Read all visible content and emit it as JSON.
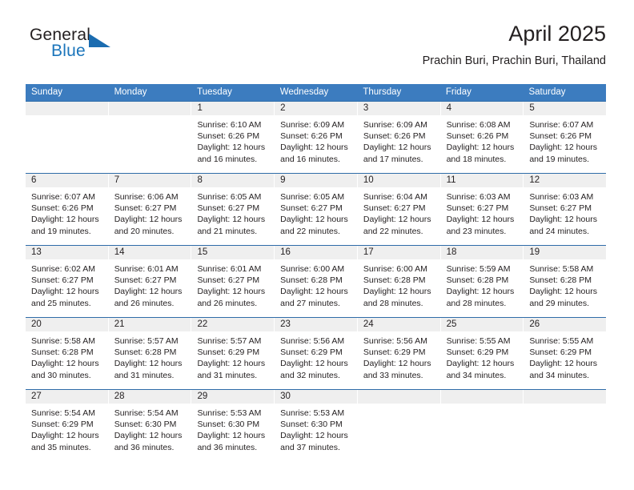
{
  "brand": {
    "name_part1": "General",
    "name_part2": "Blue"
  },
  "header": {
    "title": "April 2025",
    "location": "Prachin Buri, Prachin Buri, Thailand"
  },
  "colors": {
    "header_blue": "#3c7cbf",
    "row_divider_blue": "#2f6ca8",
    "day_band_gray": "#efefef",
    "brand_blue": "#1b75bb",
    "text": "#231f20"
  },
  "weekdays": [
    "Sunday",
    "Monday",
    "Tuesday",
    "Wednesday",
    "Thursday",
    "Friday",
    "Saturday"
  ],
  "labels": {
    "sunrise_prefix": "Sunrise:",
    "sunset_prefix": "Sunset:",
    "daylight_prefix": "Daylight:"
  },
  "weeks": [
    [
      {
        "day": "",
        "sunrise": "",
        "sunset": "",
        "daylight_line1": "",
        "daylight_line2": ""
      },
      {
        "day": "",
        "sunrise": "",
        "sunset": "",
        "daylight_line1": "",
        "daylight_line2": ""
      },
      {
        "day": "1",
        "sunrise": "Sunrise: 6:10 AM",
        "sunset": "Sunset: 6:26 PM",
        "daylight_line1": "Daylight: 12 hours",
        "daylight_line2": "and 16 minutes."
      },
      {
        "day": "2",
        "sunrise": "Sunrise: 6:09 AM",
        "sunset": "Sunset: 6:26 PM",
        "daylight_line1": "Daylight: 12 hours",
        "daylight_line2": "and 16 minutes."
      },
      {
        "day": "3",
        "sunrise": "Sunrise: 6:09 AM",
        "sunset": "Sunset: 6:26 PM",
        "daylight_line1": "Daylight: 12 hours",
        "daylight_line2": "and 17 minutes."
      },
      {
        "day": "4",
        "sunrise": "Sunrise: 6:08 AM",
        "sunset": "Sunset: 6:26 PM",
        "daylight_line1": "Daylight: 12 hours",
        "daylight_line2": "and 18 minutes."
      },
      {
        "day": "5",
        "sunrise": "Sunrise: 6:07 AM",
        "sunset": "Sunset: 6:26 PM",
        "daylight_line1": "Daylight: 12 hours",
        "daylight_line2": "and 19 minutes."
      }
    ],
    [
      {
        "day": "6",
        "sunrise": "Sunrise: 6:07 AM",
        "sunset": "Sunset: 6:26 PM",
        "daylight_line1": "Daylight: 12 hours",
        "daylight_line2": "and 19 minutes."
      },
      {
        "day": "7",
        "sunrise": "Sunrise: 6:06 AM",
        "sunset": "Sunset: 6:27 PM",
        "daylight_line1": "Daylight: 12 hours",
        "daylight_line2": "and 20 minutes."
      },
      {
        "day": "8",
        "sunrise": "Sunrise: 6:05 AM",
        "sunset": "Sunset: 6:27 PM",
        "daylight_line1": "Daylight: 12 hours",
        "daylight_line2": "and 21 minutes."
      },
      {
        "day": "9",
        "sunrise": "Sunrise: 6:05 AM",
        "sunset": "Sunset: 6:27 PM",
        "daylight_line1": "Daylight: 12 hours",
        "daylight_line2": "and 22 minutes."
      },
      {
        "day": "10",
        "sunrise": "Sunrise: 6:04 AM",
        "sunset": "Sunset: 6:27 PM",
        "daylight_line1": "Daylight: 12 hours",
        "daylight_line2": "and 22 minutes."
      },
      {
        "day": "11",
        "sunrise": "Sunrise: 6:03 AM",
        "sunset": "Sunset: 6:27 PM",
        "daylight_line1": "Daylight: 12 hours",
        "daylight_line2": "and 23 minutes."
      },
      {
        "day": "12",
        "sunrise": "Sunrise: 6:03 AM",
        "sunset": "Sunset: 6:27 PM",
        "daylight_line1": "Daylight: 12 hours",
        "daylight_line2": "and 24 minutes."
      }
    ],
    [
      {
        "day": "13",
        "sunrise": "Sunrise: 6:02 AM",
        "sunset": "Sunset: 6:27 PM",
        "daylight_line1": "Daylight: 12 hours",
        "daylight_line2": "and 25 minutes."
      },
      {
        "day": "14",
        "sunrise": "Sunrise: 6:01 AM",
        "sunset": "Sunset: 6:27 PM",
        "daylight_line1": "Daylight: 12 hours",
        "daylight_line2": "and 26 minutes."
      },
      {
        "day": "15",
        "sunrise": "Sunrise: 6:01 AM",
        "sunset": "Sunset: 6:27 PM",
        "daylight_line1": "Daylight: 12 hours",
        "daylight_line2": "and 26 minutes."
      },
      {
        "day": "16",
        "sunrise": "Sunrise: 6:00 AM",
        "sunset": "Sunset: 6:28 PM",
        "daylight_line1": "Daylight: 12 hours",
        "daylight_line2": "and 27 minutes."
      },
      {
        "day": "17",
        "sunrise": "Sunrise: 6:00 AM",
        "sunset": "Sunset: 6:28 PM",
        "daylight_line1": "Daylight: 12 hours",
        "daylight_line2": "and 28 minutes."
      },
      {
        "day": "18",
        "sunrise": "Sunrise: 5:59 AM",
        "sunset": "Sunset: 6:28 PM",
        "daylight_line1": "Daylight: 12 hours",
        "daylight_line2": "and 28 minutes."
      },
      {
        "day": "19",
        "sunrise": "Sunrise: 5:58 AM",
        "sunset": "Sunset: 6:28 PM",
        "daylight_line1": "Daylight: 12 hours",
        "daylight_line2": "and 29 minutes."
      }
    ],
    [
      {
        "day": "20",
        "sunrise": "Sunrise: 5:58 AM",
        "sunset": "Sunset: 6:28 PM",
        "daylight_line1": "Daylight: 12 hours",
        "daylight_line2": "and 30 minutes."
      },
      {
        "day": "21",
        "sunrise": "Sunrise: 5:57 AM",
        "sunset": "Sunset: 6:28 PM",
        "daylight_line1": "Daylight: 12 hours",
        "daylight_line2": "and 31 minutes."
      },
      {
        "day": "22",
        "sunrise": "Sunrise: 5:57 AM",
        "sunset": "Sunset: 6:29 PM",
        "daylight_line1": "Daylight: 12 hours",
        "daylight_line2": "and 31 minutes."
      },
      {
        "day": "23",
        "sunrise": "Sunrise: 5:56 AM",
        "sunset": "Sunset: 6:29 PM",
        "daylight_line1": "Daylight: 12 hours",
        "daylight_line2": "and 32 minutes."
      },
      {
        "day": "24",
        "sunrise": "Sunrise: 5:56 AM",
        "sunset": "Sunset: 6:29 PM",
        "daylight_line1": "Daylight: 12 hours",
        "daylight_line2": "and 33 minutes."
      },
      {
        "day": "25",
        "sunrise": "Sunrise: 5:55 AM",
        "sunset": "Sunset: 6:29 PM",
        "daylight_line1": "Daylight: 12 hours",
        "daylight_line2": "and 34 minutes."
      },
      {
        "day": "26",
        "sunrise": "Sunrise: 5:55 AM",
        "sunset": "Sunset: 6:29 PM",
        "daylight_line1": "Daylight: 12 hours",
        "daylight_line2": "and 34 minutes."
      }
    ],
    [
      {
        "day": "27",
        "sunrise": "Sunrise: 5:54 AM",
        "sunset": "Sunset: 6:29 PM",
        "daylight_line1": "Daylight: 12 hours",
        "daylight_line2": "and 35 minutes."
      },
      {
        "day": "28",
        "sunrise": "Sunrise: 5:54 AM",
        "sunset": "Sunset: 6:30 PM",
        "daylight_line1": "Daylight: 12 hours",
        "daylight_line2": "and 36 minutes."
      },
      {
        "day": "29",
        "sunrise": "Sunrise: 5:53 AM",
        "sunset": "Sunset: 6:30 PM",
        "daylight_line1": "Daylight: 12 hours",
        "daylight_line2": "and 36 minutes."
      },
      {
        "day": "30",
        "sunrise": "Sunrise: 5:53 AM",
        "sunset": "Sunset: 6:30 PM",
        "daylight_line1": "Daylight: 12 hours",
        "daylight_line2": "and 37 minutes."
      },
      {
        "day": "",
        "sunrise": "",
        "sunset": "",
        "daylight_line1": "",
        "daylight_line2": ""
      },
      {
        "day": "",
        "sunrise": "",
        "sunset": "",
        "daylight_line1": "",
        "daylight_line2": ""
      },
      {
        "day": "",
        "sunrise": "",
        "sunset": "",
        "daylight_line1": "",
        "daylight_line2": ""
      }
    ]
  ]
}
